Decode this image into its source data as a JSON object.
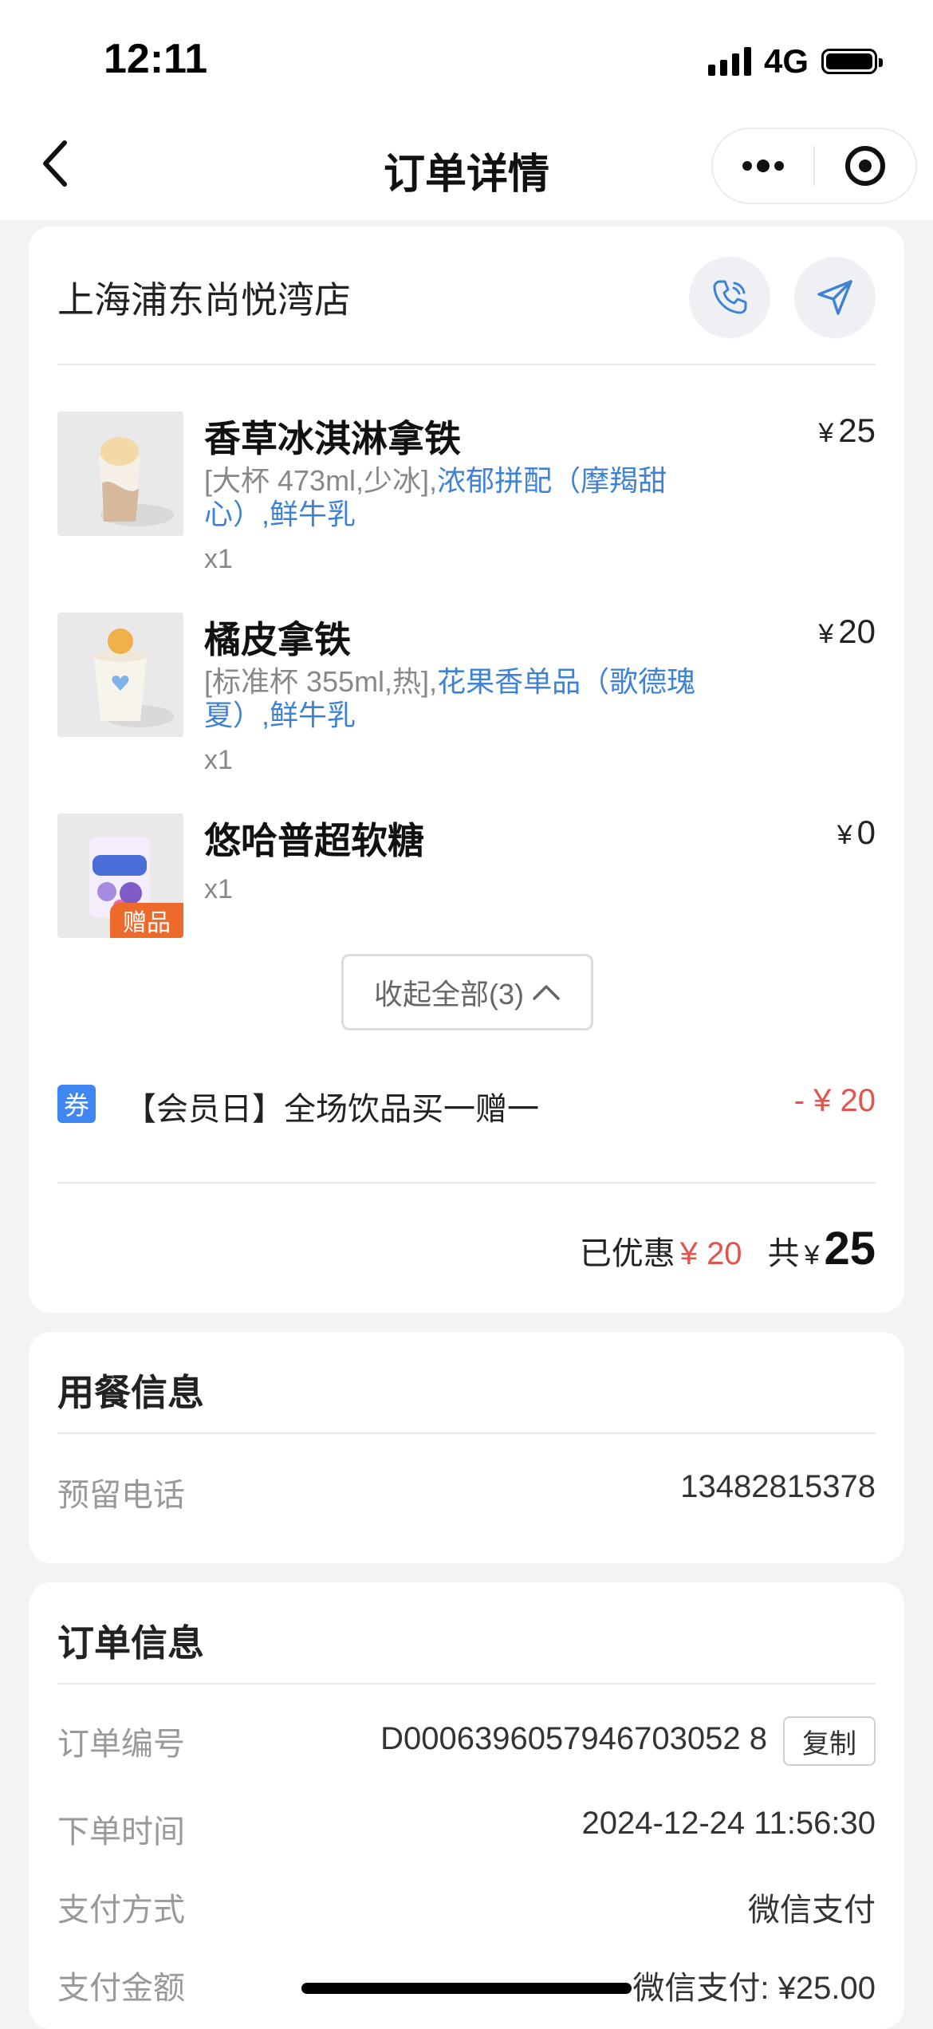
{
  "status_bar": {
    "time": "12:11",
    "network": "4G"
  },
  "nav": {
    "title": "订单详情",
    "back_icon": "chevron-left-icon",
    "more_icon": "more-dots-icon",
    "close_icon": "target-circle-icon"
  },
  "store": {
    "name": "上海浦东尚悦湾店",
    "phone_icon": "phone-icon",
    "nav_icon": "navigate-arrow-icon"
  },
  "items": [
    {
      "name": "香草冰淇淋拿铁",
      "price_symbol": "¥",
      "price": "25",
      "spec_plain": "[大杯 473ml,少冰],",
      "spec_highlight": "浓郁拼配（摩羯甜心）,鲜牛乳",
      "qty": "x1"
    },
    {
      "name": "橘皮拿铁",
      "price_symbol": "¥",
      "price": "20",
      "spec_plain": "[标准杯 355ml,热],",
      "spec_highlight": "花果香单品（歌德瑰夏）,鲜牛乳",
      "qty": "x1"
    },
    {
      "name": "悠哈普超软糖",
      "price_symbol": "¥",
      "price": "0",
      "qty": "x1",
      "tag": "赠品"
    }
  ],
  "collapse_label": "收起全部(3)",
  "coupon": {
    "badge": "券",
    "text": "【会员日】全场饮品买一赠一",
    "amount": "- ¥ 20"
  },
  "summary": {
    "discount_label": "已优惠",
    "discount": "¥ 20",
    "total_label": "共",
    "total_symbol": "¥",
    "total": "25"
  },
  "dining": {
    "title": "用餐信息",
    "phone_label": "预留电话",
    "phone": "13482815378"
  },
  "order": {
    "title": "订单信息",
    "rows": [
      {
        "label": "订单编号",
        "value": "D0006396057946703052 8"
      },
      {
        "label": "下单时间",
        "value": "2024-12-24 11:56:30"
      },
      {
        "label": "支付方式",
        "value": "微信支付"
      },
      {
        "label": "支付金额",
        "value": "微信支付: ¥25.00"
      }
    ],
    "copy_label": "复制"
  },
  "colors": {
    "accent_blue": "#3e82d6",
    "discount_red": "#e2544c",
    "gift_orange": "#ed6a2c",
    "coupon_blue": "#3f86f0"
  }
}
